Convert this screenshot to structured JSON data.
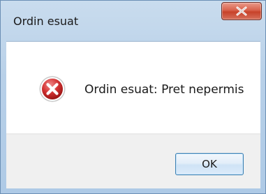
{
  "window": {
    "title": "Ordin esuat",
    "close_glyph": "x"
  },
  "dialog": {
    "icon": "error-icon",
    "message": "Ordin esuat: Pret nepermis"
  },
  "buttons": {
    "ok_label": "OK"
  },
  "colors": {
    "frame": "#b8d0e8",
    "close_button": "#c7422a",
    "error_red": "#c0282d",
    "footer": "#f0f0f0",
    "button_border": "#3c7fb1"
  }
}
